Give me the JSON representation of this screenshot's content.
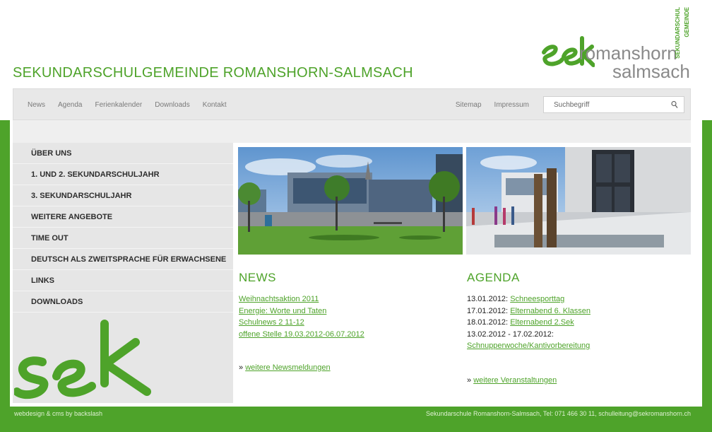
{
  "site_title": "SEKUNDARSCHULGEMEINDE ROMANSHORN-SALMSACH",
  "logo": {
    "mark": "sek",
    "town_line1": "romanshorn",
    "town_line2": "salmsach",
    "vertical_text_1": "SEKUNDARSCHUL",
    "vertical_text_2": "GEMEINDE",
    "brand_color": "#4ea32a"
  },
  "nav": {
    "left": [
      {
        "label": "News"
      },
      {
        "label": "Agenda"
      },
      {
        "label": "Ferienkalender"
      },
      {
        "label": "Downloads"
      },
      {
        "label": "Kontakt"
      }
    ],
    "right": [
      {
        "label": "Sitemap"
      },
      {
        "label": "Impressum"
      }
    ],
    "search_placeholder": "Suchbegriff",
    "search_icon": "magnifier-icon"
  },
  "sidebar": {
    "items": [
      {
        "label": "ÜBER UNS"
      },
      {
        "label": "1. UND 2. SEKUNDARSCHULJAHR"
      },
      {
        "label": "3. SEKUNDARSCHULJAHR"
      },
      {
        "label": "WEITERE ANGEBOTE"
      },
      {
        "label": "TIME OUT"
      },
      {
        "label": "DEUTSCH ALS ZWEITSPRACHE FÜR ERWACHSENE"
      },
      {
        "label": "LINKS"
      },
      {
        "label": "DOWNLOADS"
      }
    ]
  },
  "news": {
    "heading": "NEWS",
    "items": [
      {
        "label": "Weihnachtsaktion 2011"
      },
      {
        "label": "Energie: Worte und Taten"
      },
      {
        "label": "Schulnews 2 11-12"
      },
      {
        "label": "offene Stelle 19.03.2012-06.07.2012"
      }
    ],
    "more_prefix": "»",
    "more_label": "weitere Newsmeldungen"
  },
  "agenda": {
    "heading": "AGENDA",
    "items": [
      {
        "date": "13.01.2012:",
        "label": "Schneesporttag"
      },
      {
        "date": "17.01.2012:",
        "label": "Elternabend 6. Klassen"
      },
      {
        "date": "18.01.2012:",
        "label": "Elternabend 2.Sek"
      }
    ],
    "multi_date": "13.02.2012 - 17.02.2012:",
    "multi_label": "Schnupperwoche/Kantivorbereitung",
    "more_prefix": "»",
    "more_label": "weitere Veranstaltungen"
  },
  "footer": {
    "left": "webdesign & cms by backslash",
    "right": "Sekundarschule Romanshorn-Salmsach, Tel: 071 466 30 11, schulleitung@sekromanshorn.ch"
  }
}
